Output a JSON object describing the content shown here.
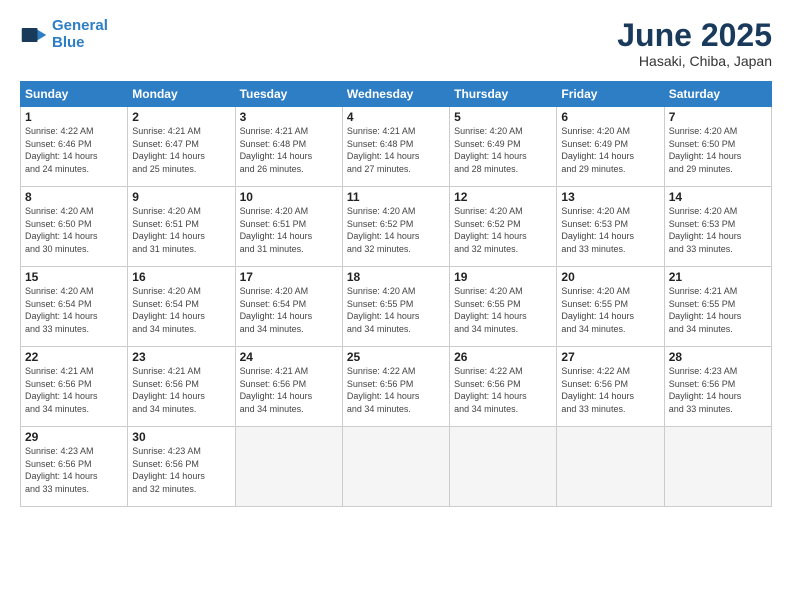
{
  "header": {
    "logo_line1": "General",
    "logo_line2": "Blue",
    "month_title": "June 2025",
    "location": "Hasaki, Chiba, Japan"
  },
  "weekdays": [
    "Sunday",
    "Monday",
    "Tuesday",
    "Wednesday",
    "Thursday",
    "Friday",
    "Saturday"
  ],
  "weeks": [
    [
      {
        "day": "1",
        "info": "Sunrise: 4:22 AM\nSunset: 6:46 PM\nDaylight: 14 hours\nand 24 minutes."
      },
      {
        "day": "2",
        "info": "Sunrise: 4:21 AM\nSunset: 6:47 PM\nDaylight: 14 hours\nand 25 minutes."
      },
      {
        "day": "3",
        "info": "Sunrise: 4:21 AM\nSunset: 6:48 PM\nDaylight: 14 hours\nand 26 minutes."
      },
      {
        "day": "4",
        "info": "Sunrise: 4:21 AM\nSunset: 6:48 PM\nDaylight: 14 hours\nand 27 minutes."
      },
      {
        "day": "5",
        "info": "Sunrise: 4:20 AM\nSunset: 6:49 PM\nDaylight: 14 hours\nand 28 minutes."
      },
      {
        "day": "6",
        "info": "Sunrise: 4:20 AM\nSunset: 6:49 PM\nDaylight: 14 hours\nand 29 minutes."
      },
      {
        "day": "7",
        "info": "Sunrise: 4:20 AM\nSunset: 6:50 PM\nDaylight: 14 hours\nand 29 minutes."
      }
    ],
    [
      {
        "day": "8",
        "info": "Sunrise: 4:20 AM\nSunset: 6:50 PM\nDaylight: 14 hours\nand 30 minutes."
      },
      {
        "day": "9",
        "info": "Sunrise: 4:20 AM\nSunset: 6:51 PM\nDaylight: 14 hours\nand 31 minutes."
      },
      {
        "day": "10",
        "info": "Sunrise: 4:20 AM\nSunset: 6:51 PM\nDaylight: 14 hours\nand 31 minutes."
      },
      {
        "day": "11",
        "info": "Sunrise: 4:20 AM\nSunset: 6:52 PM\nDaylight: 14 hours\nand 32 minutes."
      },
      {
        "day": "12",
        "info": "Sunrise: 4:20 AM\nSunset: 6:52 PM\nDaylight: 14 hours\nand 32 minutes."
      },
      {
        "day": "13",
        "info": "Sunrise: 4:20 AM\nSunset: 6:53 PM\nDaylight: 14 hours\nand 33 minutes."
      },
      {
        "day": "14",
        "info": "Sunrise: 4:20 AM\nSunset: 6:53 PM\nDaylight: 14 hours\nand 33 minutes."
      }
    ],
    [
      {
        "day": "15",
        "info": "Sunrise: 4:20 AM\nSunset: 6:54 PM\nDaylight: 14 hours\nand 33 minutes."
      },
      {
        "day": "16",
        "info": "Sunrise: 4:20 AM\nSunset: 6:54 PM\nDaylight: 14 hours\nand 34 minutes."
      },
      {
        "day": "17",
        "info": "Sunrise: 4:20 AM\nSunset: 6:54 PM\nDaylight: 14 hours\nand 34 minutes."
      },
      {
        "day": "18",
        "info": "Sunrise: 4:20 AM\nSunset: 6:55 PM\nDaylight: 14 hours\nand 34 minutes."
      },
      {
        "day": "19",
        "info": "Sunrise: 4:20 AM\nSunset: 6:55 PM\nDaylight: 14 hours\nand 34 minutes."
      },
      {
        "day": "20",
        "info": "Sunrise: 4:20 AM\nSunset: 6:55 PM\nDaylight: 14 hours\nand 34 minutes."
      },
      {
        "day": "21",
        "info": "Sunrise: 4:21 AM\nSunset: 6:55 PM\nDaylight: 14 hours\nand 34 minutes."
      }
    ],
    [
      {
        "day": "22",
        "info": "Sunrise: 4:21 AM\nSunset: 6:56 PM\nDaylight: 14 hours\nand 34 minutes."
      },
      {
        "day": "23",
        "info": "Sunrise: 4:21 AM\nSunset: 6:56 PM\nDaylight: 14 hours\nand 34 minutes."
      },
      {
        "day": "24",
        "info": "Sunrise: 4:21 AM\nSunset: 6:56 PM\nDaylight: 14 hours\nand 34 minutes."
      },
      {
        "day": "25",
        "info": "Sunrise: 4:22 AM\nSunset: 6:56 PM\nDaylight: 14 hours\nand 34 minutes."
      },
      {
        "day": "26",
        "info": "Sunrise: 4:22 AM\nSunset: 6:56 PM\nDaylight: 14 hours\nand 34 minutes."
      },
      {
        "day": "27",
        "info": "Sunrise: 4:22 AM\nSunset: 6:56 PM\nDaylight: 14 hours\nand 33 minutes."
      },
      {
        "day": "28",
        "info": "Sunrise: 4:23 AM\nSunset: 6:56 PM\nDaylight: 14 hours\nand 33 minutes."
      }
    ],
    [
      {
        "day": "29",
        "info": "Sunrise: 4:23 AM\nSunset: 6:56 PM\nDaylight: 14 hours\nand 33 minutes."
      },
      {
        "day": "30",
        "info": "Sunrise: 4:23 AM\nSunset: 6:56 PM\nDaylight: 14 hours\nand 32 minutes."
      },
      {
        "day": "",
        "info": "",
        "empty": true
      },
      {
        "day": "",
        "info": "",
        "empty": true
      },
      {
        "day": "",
        "info": "",
        "empty": true
      },
      {
        "day": "",
        "info": "",
        "empty": true
      },
      {
        "day": "",
        "info": "",
        "empty": true
      }
    ]
  ]
}
